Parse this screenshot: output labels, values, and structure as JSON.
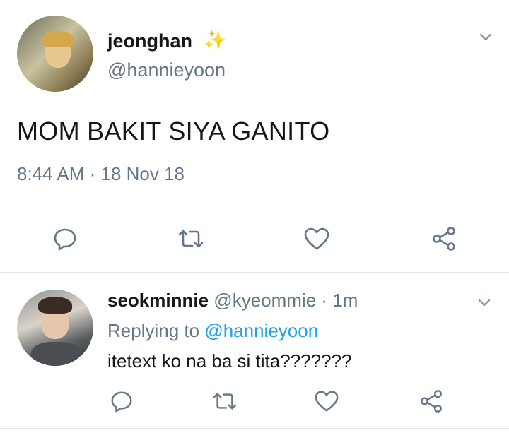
{
  "main_tweet": {
    "display_name": "jeonghan",
    "name_emoji": "✨",
    "handle": "@hannieyoon",
    "text": "MOM BAKIT SIYA GANITO",
    "timestamp": "8:44 AM · 18 Nov 18",
    "actions": [
      "reply-icon",
      "retweet-icon",
      "like-icon",
      "share-icon"
    ]
  },
  "reply_tweet": {
    "display_name": "seokminnie",
    "handle": "@kyeommie",
    "separator": " · ",
    "time_ago": "1m",
    "replying_prefix": "Replying to ",
    "replying_to": "@hannieyoon",
    "text": "itetext ko na ba si tita???????",
    "actions": [
      "reply-icon",
      "retweet-icon",
      "like-icon",
      "share-icon"
    ]
  },
  "colors": {
    "text_primary": "#14171a",
    "text_secondary": "#657786",
    "link": "#1da1f2",
    "divider": "#e1e8ed"
  }
}
